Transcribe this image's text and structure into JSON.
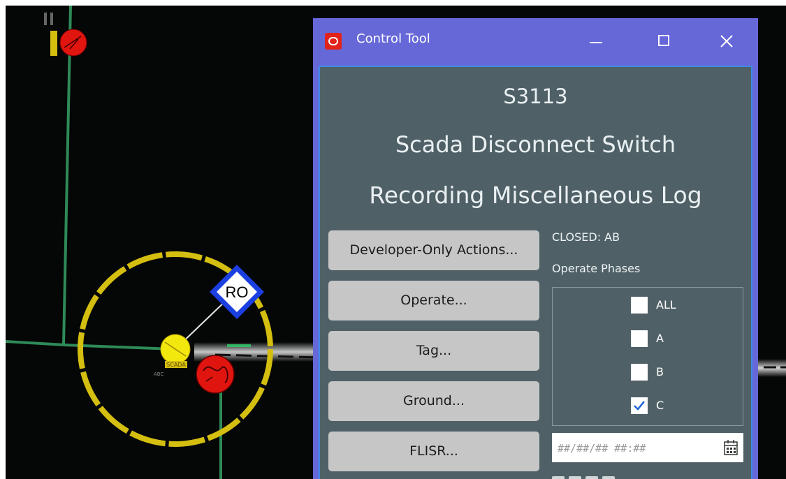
{
  "map": {
    "ro_marker": "RO",
    "device_small_labels": [
      "SCADA",
      "ABC"
    ]
  },
  "window": {
    "title": "Control Tool",
    "minimize_icon": "minimize-icon",
    "maximize_icon": "maximize-icon",
    "close_icon": "close-icon"
  },
  "device": {
    "id": "S3113",
    "type": "Scada Disconnect Switch",
    "mode": "Recording Miscellaneous Log"
  },
  "actions": [
    {
      "label": "Developer-Only Actions..."
    },
    {
      "label": "Operate..."
    },
    {
      "label": "Tag..."
    },
    {
      "label": "Ground..."
    },
    {
      "label": "FLISR..."
    }
  ],
  "status": "CLOSED: AB",
  "operate_phases": {
    "label": "Operate Phases",
    "options": [
      {
        "label": "ALL",
        "checked": false
      },
      {
        "label": "A",
        "checked": false
      },
      {
        "label": "B",
        "checked": false
      },
      {
        "label": "C",
        "checked": true
      }
    ]
  },
  "datetime": {
    "placeholder": "##/##/## ##:##",
    "icon": "calendar-icon"
  },
  "colors": {
    "titlebar": "#6768d7",
    "panel": "#4f6167",
    "button": "#c6c6c6",
    "map_background": "#050606",
    "feeder_line": "#2e8a57",
    "highlight_ring": "#d4be10",
    "breaker": "#e0150f",
    "ro_marker": "#1b3fe0"
  }
}
